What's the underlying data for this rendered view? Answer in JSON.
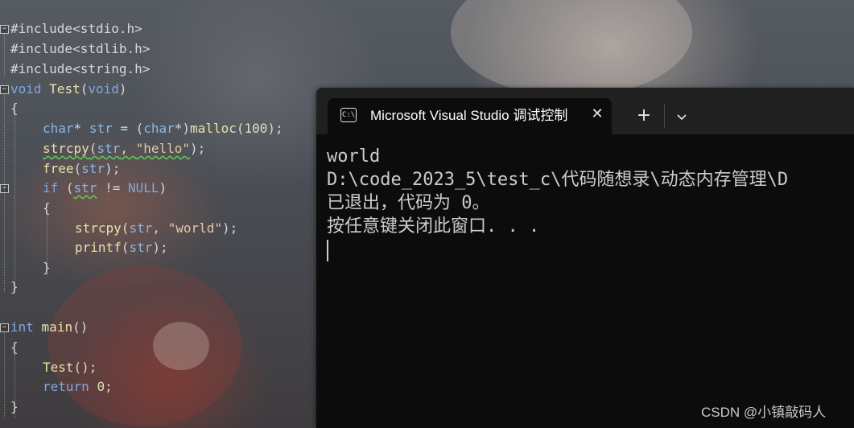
{
  "editor": {
    "line1": "#include<stdio.h>",
    "line2": "#include<stdlib.h>",
    "line3": "#include<string.h>",
    "line4_kw": "void",
    "line4_fn": "Test",
    "line4_open": "(",
    "line4_param": "void",
    "line4_close": ")",
    "brace_open": "{",
    "brace_close": "}",
    "l6_type": "char",
    "l6_star": "*",
    "l6_var": "str",
    "l6_eq": " = (",
    "l6_cast": "char",
    "l6_cast2": "*)",
    "l6_fn": "malloc",
    "l6_open": "(",
    "l6_num": "100",
    "l6_end": ");",
    "l7_fn": "strcpy",
    "l7_open": "(",
    "l7_arg": "str",
    "l7_sep": ", ",
    "l7_str": "\"hello\"",
    "l7_end": ");",
    "l8_fn": "free",
    "l8_open": "(",
    "l8_arg": "str",
    "l8_end": ");",
    "l9_kw": "if",
    "l9_open": " (",
    "l9_arg": "str",
    "l9_op": " != ",
    "l9_null": "NULL",
    "l9_close": ")",
    "l11_fn": "strcpy",
    "l11_open": "(",
    "l11_arg": "str",
    "l11_sep": ", ",
    "l11_str": "\"world\"",
    "l11_end": ");",
    "l12_fn": "printf",
    "l12_open": "(",
    "l12_arg": "str",
    "l12_end": ");",
    "l16_kw": "int",
    "l16_fn": "main",
    "l16_paren": "()",
    "l18_fn": "Test",
    "l18_end": "();",
    "l19_kw": "return",
    "l19_num": "0",
    "l19_end": ";",
    "fold_glyph": "−"
  },
  "terminal": {
    "tab_icon": "C:\\",
    "tab_title": "Microsoft Visual Studio 调试控制台",
    "close_glyph": "✕",
    "new_tab_glyph": "+",
    "dropdown_icon": "chevron-down-icon",
    "output": [
      "world",
      "D:\\code_2023_5\\test_c\\代码随想录\\动态内存管理\\D",
      "已退出，代码为 0。",
      "按任意键关闭此窗口. . ."
    ]
  },
  "watermark": "CSDN @小镇敲码人",
  "colors": {
    "terminal_bg": "#0c0c0c",
    "titlebar_bg": "#202020",
    "terminal_text": "#cccccc"
  }
}
